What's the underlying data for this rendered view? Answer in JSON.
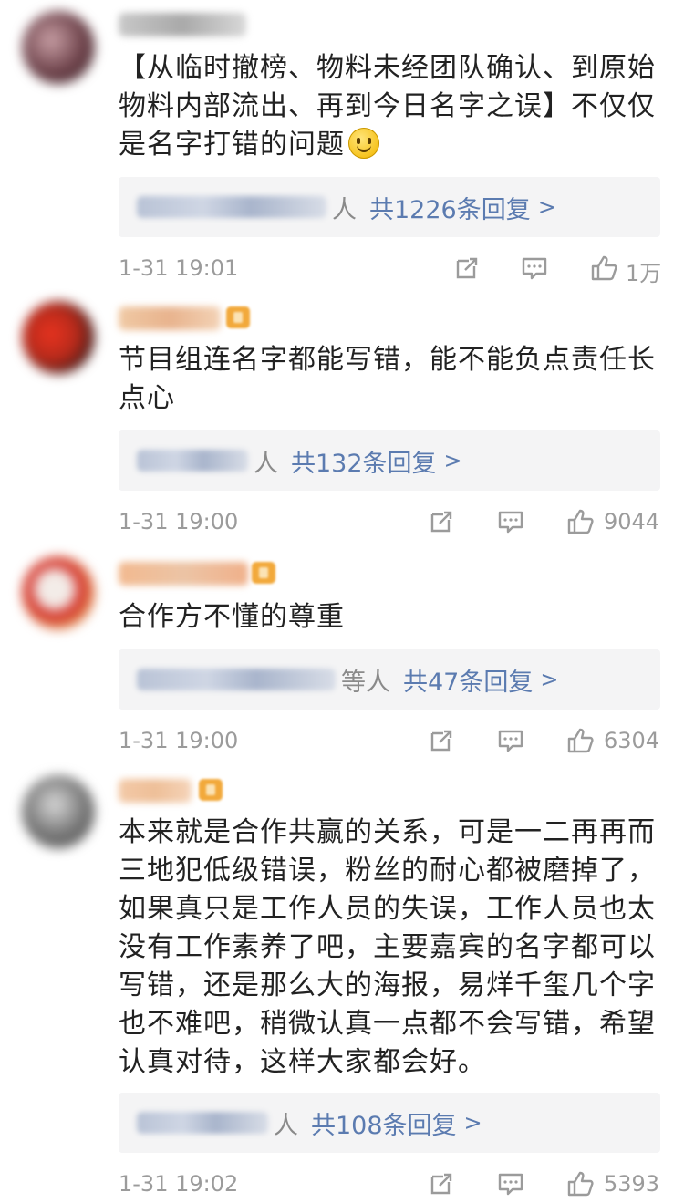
{
  "comments": [
    {
      "text": "【从临时撤榜、物料未经团队确认、到原始物料内部流出、再到今日名字之误】不仅仅是名字打错的问题",
      "has_emoji": true,
      "reply_prefix": "人",
      "reply_count_label": "共1226条回复",
      "time": "1-31 19:01",
      "likes": "1万",
      "avatar_colors": [
        "#3b2a2e",
        "#c9a0a6",
        "#6b4048"
      ]
    },
    {
      "text": "节目组连名字都能写错，能不能负点责任长点心",
      "reply_prefix": "人",
      "reply_count_label": "共132条回复",
      "time": "1-31 19:00",
      "likes": "9044",
      "avatar_colors": [
        "#e8331f",
        "#2a1a1a",
        "#b52a1b"
      ]
    },
    {
      "text": "合作方不懂的尊重",
      "reply_prefix": "等人",
      "reply_count_label": "共47条回复",
      "time": "1-31 19:00",
      "likes": "6304",
      "avatar_colors": [
        "#d32a26",
        "#f3ece8",
        "#e8c26a"
      ]
    },
    {
      "text": "本来就是合作共赢的关系，可是一二再再而三地犯低级错误，粉丝的耐心都被磨掉了，如果真只是工作人员的失误，工作人员也太没有工作素养了吧，主要嘉宾的名字都可以写错，还是那么大的海报，易烊千玺几个字也不难吧，稍微认真一点都不会写错，希望认真对待，这样大家都会好。",
      "reply_prefix": "人",
      "reply_count_label": "共108条回复",
      "time": "1-31 19:02",
      "likes": "5393",
      "avatar_colors": [
        "#7a7a7a",
        "#d9d9d9",
        "#3f3f3f"
      ]
    }
  ],
  "reply_arrow": ">",
  "icons": [
    "share-icon",
    "comment-icon",
    "like-icon"
  ],
  "colors": {
    "link": "#5b7bb0",
    "meta": "#9b9b9b",
    "reply_bg": "#f4f4f5",
    "vip": "#f2a93b"
  }
}
